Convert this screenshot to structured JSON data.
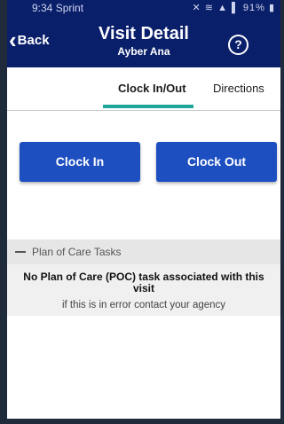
{
  "status_bar": {
    "time": "9:34 Sprint",
    "icons": "✕ ≋ ▲ ▌ 91% ▮"
  },
  "header": {
    "back_label": "Back",
    "title": "Visit Detail",
    "subtitle": "Ayber Ana",
    "help_icon": "?"
  },
  "tabs": [
    {
      "label": "Clock In/Out",
      "active": true
    },
    {
      "label": "Directions",
      "active": false
    }
  ],
  "actions": {
    "clock_in": "Clock In",
    "clock_out": "Clock Out"
  },
  "poc": {
    "section_label": "Plan of Care Tasks",
    "empty_title": "No Plan of Care (POC) task associated with this visit",
    "empty_note": "if this is in error contact your agency"
  },
  "colors": {
    "header": "#0a1f6a",
    "accent": "#20a59a",
    "button": "#1e4fc1"
  }
}
